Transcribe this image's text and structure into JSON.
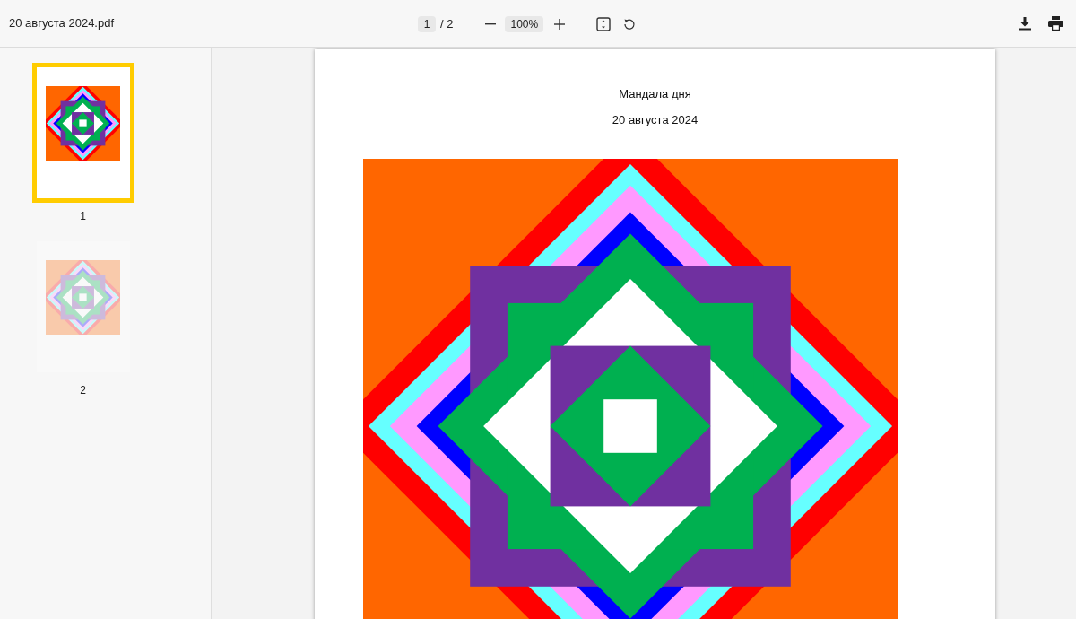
{
  "document": {
    "filename": "20 августа 2024.pdf"
  },
  "toolbar": {
    "page_value": "1",
    "page_total": "/ 2",
    "zoom": "100%"
  },
  "thumbnails": [
    {
      "label": "1",
      "selected": true
    },
    {
      "label": "2",
      "selected": false
    }
  ],
  "page": {
    "title": "Мандала дня",
    "date": "20 августа 2024"
  }
}
